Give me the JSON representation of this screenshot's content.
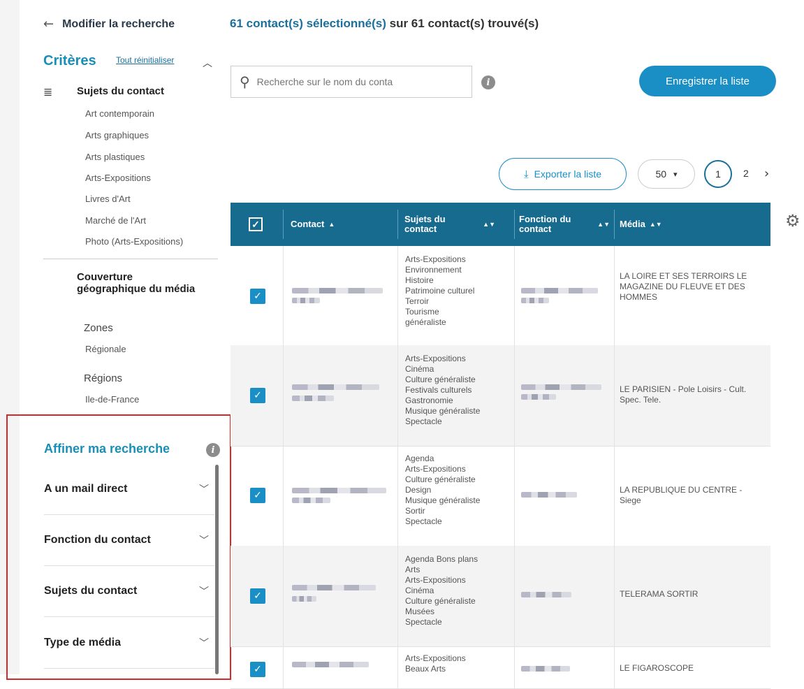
{
  "nav": {
    "back_label": "Modifier la recherche"
  },
  "header": {
    "selected_prefix": "61 contact(s) sélectionné(s)",
    "selected_suffix": " sur 61 contact(s) trouvé(s)"
  },
  "criteria": {
    "title": "Critères",
    "reset_label": "Tout réinitialiser",
    "subjects_heading": "Sujets du contact",
    "subjects": [
      "Art contemporain",
      "Arts graphiques",
      "Arts plastiques",
      "Arts-Expositions",
      "Livres d'Art",
      "Marché de l'Art",
      "Photo (Arts-Expositions)"
    ],
    "coverage_heading": "Couverture géographique du média",
    "zones_label": "Zones",
    "zones_value": "Régionale",
    "regions_label": "Régions",
    "regions_value": "Ile-de-France"
  },
  "refine": {
    "title": "Affiner ma recherche",
    "filters": [
      "A un mail direct",
      "Fonction du contact",
      "Sujets du contact",
      "Type de média"
    ]
  },
  "search": {
    "placeholder": "Recherche sur le nom du conta"
  },
  "toolbar": {
    "save_label": "Enregistrer la liste",
    "export_label": "Exporter la liste",
    "page_size": "50",
    "current_page": "1",
    "next_page": "2"
  },
  "table": {
    "columns": {
      "contact": "Contact",
      "subjects": "Sujets du contact",
      "function": "Fonction du contact",
      "media": "Média"
    },
    "rows": [
      {
        "subjects": "Arts-Expositions\nEnvironnement\nHistoire\nPatrimoine culturel\nTerroir\nTourisme\ngénéraliste",
        "media": "LA LOIRE ET SES TERROIRS LE MAGAZINE DU FLEUVE ET DES HOMMES"
      },
      {
        "subjects": "Arts-Expositions\nCinéma\nCulture généraliste\nFestivals culturels\nGastronomie\nMusique généraliste\nSpectacle",
        "media": "LE PARISIEN - Pole Loisirs - Cult. Spec. Tele."
      },
      {
        "subjects": "Agenda\nArts-Expositions\nCulture généraliste\nDesign\nMusique généraliste\nSortir\nSpectacle",
        "media": "LA REPUBLIQUE DU CENTRE - Siege"
      },
      {
        "subjects": "Agenda Bons plans\nArts\nArts-Expositions\nCinéma\nCulture généraliste\nMusées\nSpectacle",
        "media": "TELERAMA SORTIR"
      },
      {
        "subjects": "Arts-Expositions\nBeaux Arts",
        "media": "LE FIGAROSCOPE"
      }
    ]
  }
}
